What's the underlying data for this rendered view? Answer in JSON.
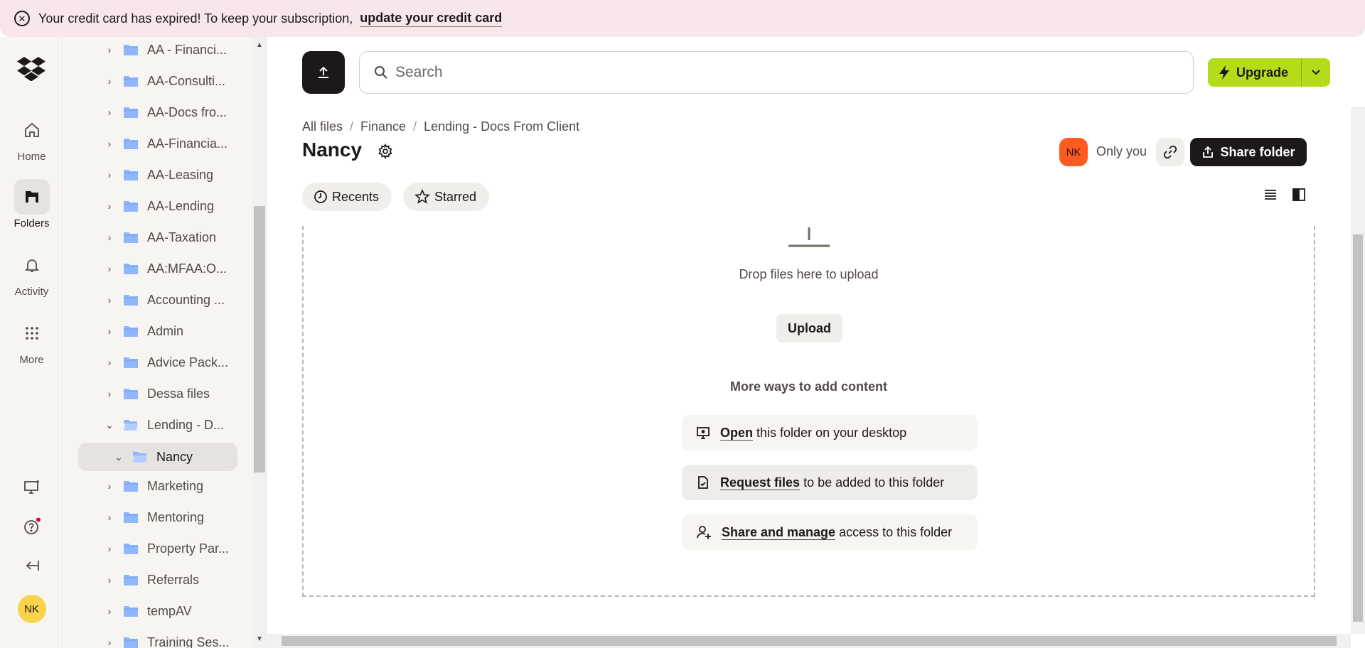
{
  "banner": {
    "message": "Your credit card has expired! To keep your subscription,",
    "link": "update your credit card"
  },
  "rail": {
    "home": "Home",
    "folders": "Folders",
    "activity": "Activity",
    "more": "More",
    "user_initials": "NK"
  },
  "tree": {
    "items": [
      {
        "label": "AA - Financi..."
      },
      {
        "label": "AA-Consulti..."
      },
      {
        "label": "AA-Docs fro..."
      },
      {
        "label": "AA-Financia..."
      },
      {
        "label": "AA-Leasing"
      },
      {
        "label": "AA-Lending"
      },
      {
        "label": "AA-Taxation"
      },
      {
        "label": "AA:MFAA:O..."
      },
      {
        "label": "Accounting ..."
      },
      {
        "label": "Admin"
      },
      {
        "label": "Advice Pack..."
      },
      {
        "label": "Dessa files"
      },
      {
        "label": "Lending - D..."
      },
      {
        "label": "Nancy"
      },
      {
        "label": "Marketing"
      },
      {
        "label": "Mentoring"
      },
      {
        "label": "Property Par..."
      },
      {
        "label": "Referrals"
      },
      {
        "label": "tempAV"
      },
      {
        "label": "Training Ses..."
      }
    ]
  },
  "header": {
    "search_placeholder": "Search",
    "upgrade": "Upgrade"
  },
  "breadcrumb": [
    "All files",
    "Finance",
    "Lending - Docs From Client"
  ],
  "folder": {
    "title": "Nancy",
    "owner_initials": "NK",
    "sharing_status": "Only you",
    "share_button": "Share folder"
  },
  "filters": {
    "recents": "Recents",
    "starred": "Starred"
  },
  "dropzone": {
    "hint": "Drop files here to upload",
    "upload": "Upload",
    "more_heading": "More ways to add content",
    "options": [
      {
        "bold": "Open",
        "rest": "this folder on your desktop",
        "icon": "desktop-icon"
      },
      {
        "bold": "Request files",
        "rest": "to be added to this folder",
        "icon": "request-file-icon"
      },
      {
        "bold": "Share and manage",
        "rest": "access to this folder",
        "icon": "person-add-icon"
      }
    ]
  },
  "colors": {
    "banner_bg": "#f7e6ea",
    "upgrade_green": "#b4dc19",
    "owner_avatar": "#ff5a1f",
    "user_avatar": "#fad24b",
    "folder_blue": "#8fb6ff"
  }
}
